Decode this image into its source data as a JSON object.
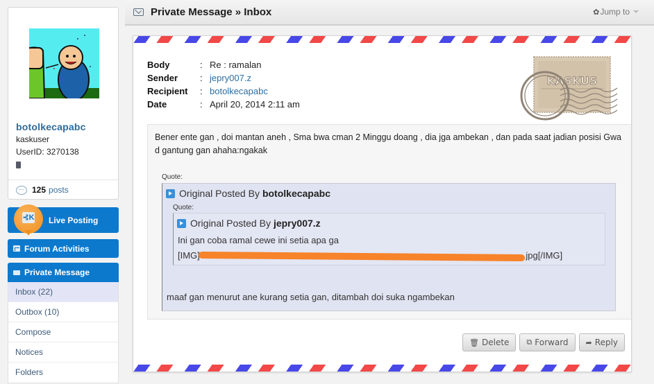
{
  "sidebar": {
    "profile": {
      "username": "botolkecapabc",
      "title": "kaskuser",
      "user_id": "UserID: 3270138",
      "post_count": "125",
      "posts_label": "posts"
    },
    "nav": {
      "live_posting": "Live Posting",
      "forum_activities": "Forum Activities",
      "private_message": "Private Message",
      "pm_items": [
        {
          "label": "Inbox (22)",
          "active": true
        },
        {
          "label": "Outbox (10)",
          "active": false
        },
        {
          "label": "Compose",
          "active": false
        },
        {
          "label": "Notices",
          "active": false
        },
        {
          "label": "Folders",
          "active": false
        }
      ]
    }
  },
  "header": {
    "title": "Private Message » Inbox",
    "jump_to": "Jump to"
  },
  "message": {
    "labels": {
      "body": "Body",
      "sender": "Sender",
      "recipient": "Recipient",
      "date": "Date",
      "colon": ":"
    },
    "subject": "Re : ramalan",
    "sender": "jepry007.z",
    "recipient": "botolkecapabc",
    "date": "April 20, 2014 2:11 am",
    "stamp_text": "KASKUS",
    "body_text": "Bener ente gan , doi mantan aneh , Sma bwa cman 2 Minggu doang , dia jga ambekan , dan pada saat jadian posisi Gwa d gantung gan ahaha:ngakak",
    "quote_label": "Quote:",
    "quote1": {
      "prefix": "Original Posted By",
      "author": "botolkecapabc",
      "reply": "maaf gan menurut ane kurang setia gan, ditambah doi suka ngambekan"
    },
    "quote2": {
      "prefix": "Original Posted By",
      "author": "jepry007.z",
      "line1": "Ini gan coba ramal cewe ini setia apa ga",
      "img_open": "[IMG]",
      "img_close": ".jpg[/IMG]"
    }
  },
  "actions": {
    "delete": "Delete",
    "forward": "Forward",
    "reply": "Reply"
  },
  "colors": {
    "brand_blue": "#0c79cd",
    "link": "#2c6ea2",
    "stripe_red": "#f24848",
    "stripe_blue": "#4848e8",
    "redaction": "#f7832a"
  }
}
